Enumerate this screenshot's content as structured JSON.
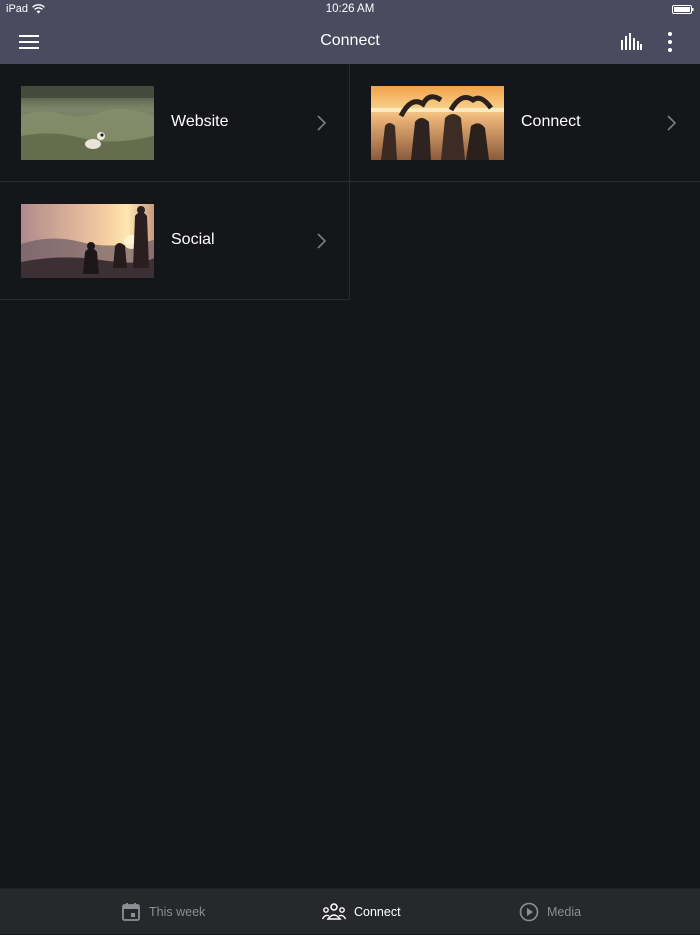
{
  "status_bar": {
    "carrier": "iPad",
    "time": "10:26 AM"
  },
  "nav": {
    "title": "Connect",
    "menu_icon": "hamburger-menu-icon",
    "stats_icon": "bar-chart-icon",
    "more_icon": "vertical-dots-icon"
  },
  "items": [
    {
      "label": "Website",
      "image": "dog-in-field-photo"
    },
    {
      "label": "Connect",
      "image": "heart-hands-sunset-photo"
    },
    {
      "label": "Social",
      "image": "people-on-mountain-sunset-photo"
    }
  ],
  "tabs": [
    {
      "label": "This week",
      "icon": "calendar-icon",
      "active": false
    },
    {
      "label": "Connect",
      "icon": "group-people-icon",
      "active": true
    },
    {
      "label": "Media",
      "icon": "play-circle-icon",
      "active": false
    }
  ],
  "colors": {
    "nav_background": "#4a4b5e",
    "content_background": "#151619",
    "tab_bar_background": "#27282c",
    "inactive_tab": "#8d8e94"
  }
}
